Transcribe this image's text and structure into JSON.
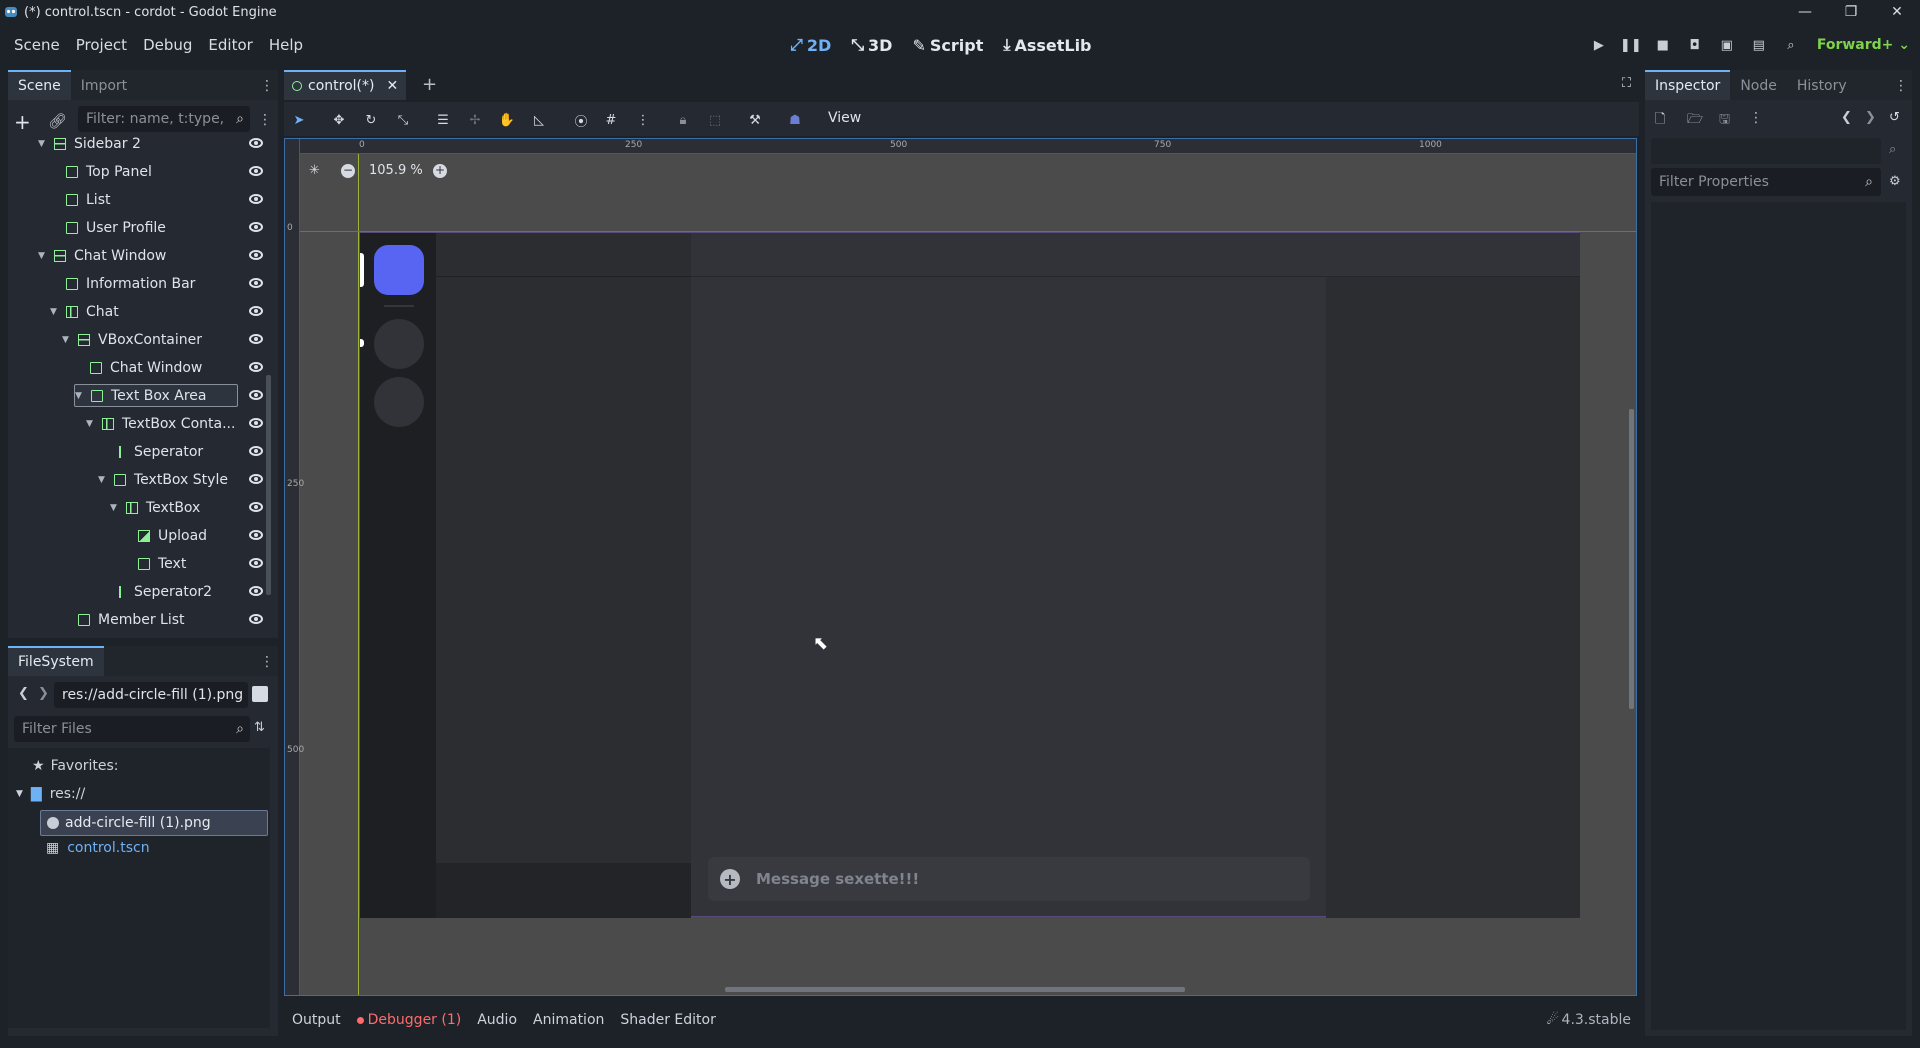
{
  "window": {
    "title": "(*) control.tscn - cordot - Godot Engine"
  },
  "menu": [
    "Scene",
    "Project",
    "Debug",
    "Editor",
    "Help"
  ],
  "workspaces": [
    {
      "label": "2D",
      "active": true
    },
    {
      "label": "3D",
      "active": false
    },
    {
      "label": "Script",
      "active": false
    },
    {
      "label": "AssetLib",
      "active": false
    }
  ],
  "renderer": "Forward+",
  "scene_dock": {
    "tabs": [
      "Scene",
      "Import"
    ],
    "filter_placeholder": "Filter: name, t:type,",
    "tree": [
      {
        "label": "Sidebar 2",
        "indent": 1,
        "expanded": true,
        "type": "vbox"
      },
      {
        "label": "Top Panel",
        "indent": 2,
        "expanded": null,
        "type": "control"
      },
      {
        "label": "List",
        "indent": 2,
        "expanded": null,
        "type": "control"
      },
      {
        "label": "User Profile",
        "indent": 2,
        "expanded": null,
        "type": "control"
      },
      {
        "label": "Chat Window",
        "indent": 1,
        "expanded": true,
        "type": "vbox"
      },
      {
        "label": "Information Bar",
        "indent": 2,
        "expanded": null,
        "type": "control"
      },
      {
        "label": "Chat",
        "indent": 2,
        "expanded": true,
        "type": "hbox"
      },
      {
        "label": "VBoxContainer",
        "indent": 3,
        "expanded": true,
        "type": "vbox"
      },
      {
        "label": "Chat Window",
        "indent": 4,
        "expanded": null,
        "type": "control"
      },
      {
        "label": "Text Box Area",
        "indent": 4,
        "expanded": true,
        "type": "control",
        "selected": true
      },
      {
        "label": "TextBox Conta...",
        "indent": 5,
        "expanded": true,
        "type": "hbox"
      },
      {
        "label": "Seperator",
        "indent": 6,
        "expanded": null,
        "type": "sep"
      },
      {
        "label": "TextBox Style",
        "indent": 6,
        "expanded": true,
        "type": "control"
      },
      {
        "label": "TextBox",
        "indent": 7,
        "expanded": true,
        "type": "hbox"
      },
      {
        "label": "Upload",
        "indent": 8,
        "expanded": null,
        "type": "texture"
      },
      {
        "label": "Text",
        "indent": 8,
        "expanded": null,
        "type": "control"
      },
      {
        "label": "Seperator2",
        "indent": 6,
        "expanded": null,
        "type": "sep"
      },
      {
        "label": "Member List",
        "indent": 3,
        "expanded": null,
        "type": "control"
      }
    ]
  },
  "filesystem": {
    "tab": "FileSystem",
    "path": "res://add-circle-fill (1).png",
    "filter_placeholder": "Filter Files",
    "favorites": "Favorites:",
    "root": "res://",
    "files": [
      {
        "name": "add-circle-fill (1).png",
        "selected": true
      },
      {
        "name": "control.tscn",
        "selected": false
      }
    ]
  },
  "editor": {
    "scene_tab": "control(*)",
    "view_menu": "View",
    "zoom": "105.9 %",
    "ruler_top": [
      "0",
      "250",
      "500",
      "750",
      "1000"
    ],
    "ruler_left": [
      "0",
      "250",
      "500"
    ],
    "message_placeholder": "Message sexette!!!"
  },
  "inspector": {
    "tabs": [
      "Inspector",
      "Node",
      "History"
    ],
    "filter_placeholder": "Filter Properties"
  },
  "bottom_bar": {
    "tabs": [
      "Output",
      "Debugger (1)",
      "Audio",
      "Animation",
      "Shader Editor"
    ],
    "version": "4.3.stable"
  },
  "colors": {
    "accent": "#6fb1f5",
    "node": "#8eef97",
    "error": "#ff6b6b",
    "blurple": "#5865f2"
  }
}
